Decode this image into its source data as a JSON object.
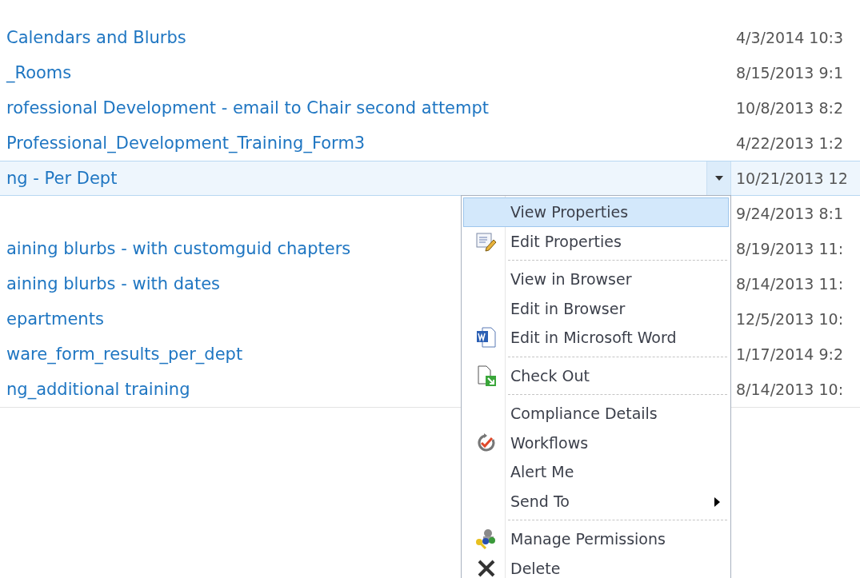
{
  "rows": [
    {
      "title": "Calendars and Blurbs",
      "modified": "4/3/2014 10:3",
      "selected": false
    },
    {
      "title": "_Rooms",
      "modified": "8/15/2013 9:1",
      "selected": false
    },
    {
      "title": "rofessional Development - email to Chair second attempt",
      "modified": "10/8/2013 8:2",
      "selected": false
    },
    {
      "title": "Professional_Development_Training_Form3",
      "modified": "4/22/2013 1:2",
      "selected": false
    },
    {
      "title": "ng - Per Dept",
      "modified": "10/21/2013 12",
      "selected": true
    },
    {
      "modified": "9/24/2013 8:1",
      "selected": false
    },
    {
      "title": "aining blurbs - with customguid chapters",
      "modified": "8/19/2013 11:",
      "selected": false
    },
    {
      "title": "aining blurbs - with dates",
      "modified": "8/14/2013 11:",
      "selected": false
    },
    {
      "title": "epartments",
      "modified": "12/5/2013 10:",
      "selected": false
    },
    {
      "title": "ware_form_results_per_dept",
      "modified": "1/17/2014 9:2",
      "selected": false
    },
    {
      "title": "ng_additional training",
      "modified": "8/14/2013 10:",
      "selected": false
    }
  ],
  "menu": {
    "items": [
      {
        "kind": "item",
        "label": "View Properties",
        "selected": true
      },
      {
        "kind": "item",
        "label": "Edit Properties",
        "selected": false
      },
      {
        "kind": "separator"
      },
      {
        "kind": "item",
        "label": "View in Browser",
        "selected": false
      },
      {
        "kind": "item",
        "label": "Edit in Browser",
        "selected": false
      },
      {
        "kind": "item",
        "label": "Edit in Microsoft Word",
        "selected": false
      },
      {
        "kind": "separator"
      },
      {
        "kind": "item",
        "label": "Check Out",
        "selected": false
      },
      {
        "kind": "separator"
      },
      {
        "kind": "item",
        "label": "Compliance Details",
        "selected": false
      },
      {
        "kind": "item",
        "label": "Workflows",
        "selected": false
      },
      {
        "kind": "item",
        "label": "Alert Me",
        "selected": false
      },
      {
        "kind": "item",
        "label": "Send To",
        "submenu": true,
        "selected": false
      },
      {
        "kind": "separator"
      },
      {
        "kind": "item",
        "label": "Manage Permissions",
        "selected": false
      },
      {
        "kind": "item",
        "label": "Delete",
        "selected": false
      }
    ]
  }
}
